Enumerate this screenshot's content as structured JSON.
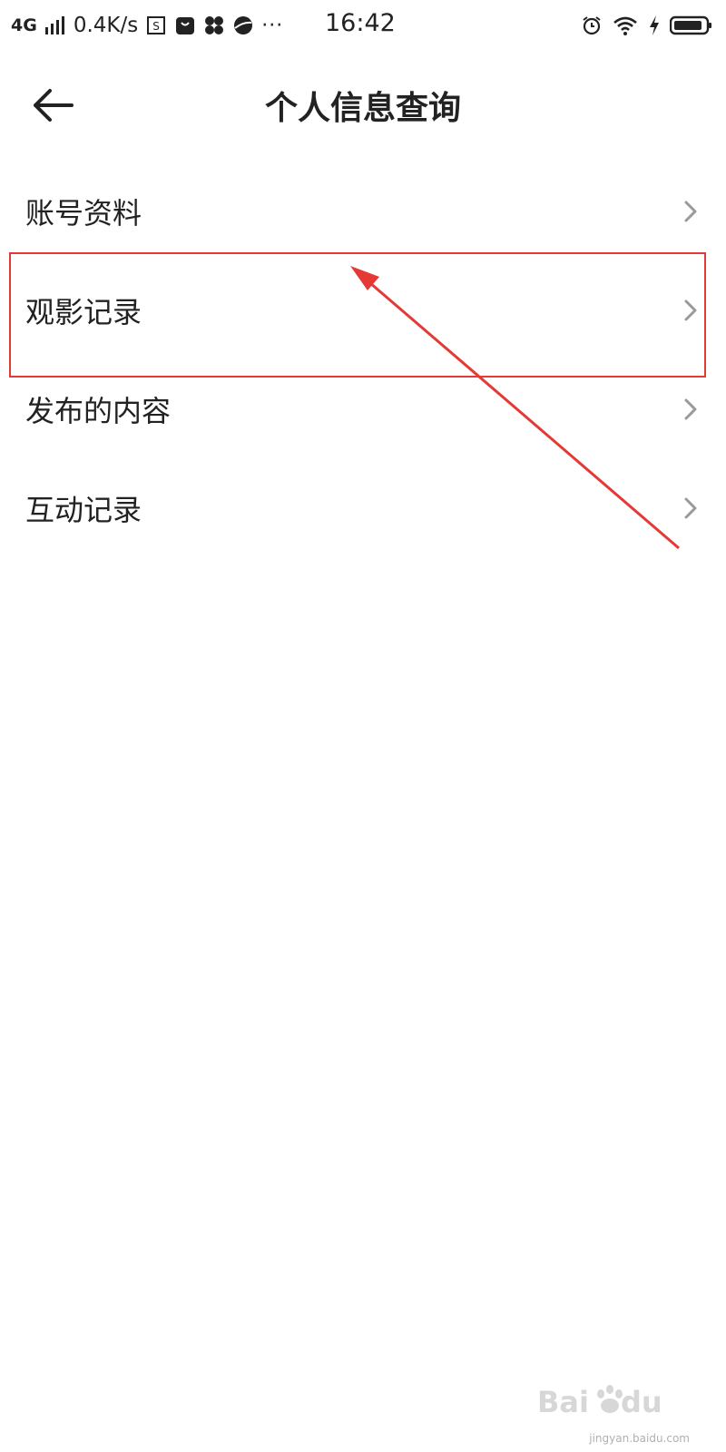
{
  "status_bar": {
    "network_type": "4G",
    "speed": "0.4K/s",
    "time": "16:42",
    "more": "···",
    "icons": [
      "signal-icon",
      "sim-icon",
      "bag-icon",
      "pinwheel-icon",
      "browser-icon",
      "alarm-icon",
      "wifi-icon",
      "charging-icon",
      "battery-icon"
    ]
  },
  "header": {
    "title": "个人信息查询",
    "back_icon": "arrow-left-icon"
  },
  "menu": {
    "items": [
      {
        "label": "账号资料"
      },
      {
        "label": "观影记录"
      },
      {
        "label": "发布的内容"
      },
      {
        "label": "互动记录"
      }
    ]
  },
  "annotation": {
    "highlight_color": "#e53935",
    "highlighted_item": "观影记录"
  },
  "watermark": {
    "brand": "Baidu 经验",
    "url": "jingyan.baidu.com"
  }
}
